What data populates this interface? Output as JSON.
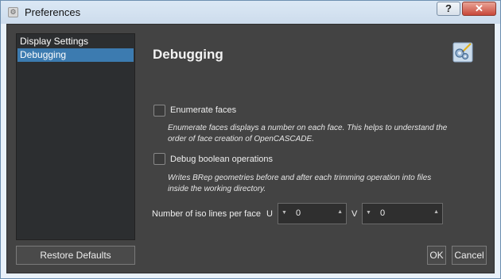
{
  "window": {
    "title": "Preferences",
    "help_label": "?",
    "close_label": "✕"
  },
  "sidebar": {
    "items": [
      {
        "label": "Display Settings"
      },
      {
        "label": "Debugging"
      }
    ]
  },
  "restore_label": "Restore Defaults",
  "page": {
    "title": "Debugging",
    "enumerate": {
      "label": "Enumerate faces",
      "desc1": "Enumerate faces displays a number on each face. This helps to understand the",
      "desc2": "order of face creation of OpenCASCADE."
    },
    "debug_bool": {
      "label": "Debug boolean operations",
      "desc1": "Writes BRep geometries before and after each trimming operation into files",
      "desc2": "inside the working directory."
    },
    "iso": {
      "label": "Number of iso lines per face",
      "u_label": "U",
      "u_value": "0",
      "v_label": "V",
      "v_value": "0"
    }
  },
  "buttons": {
    "ok": "OK",
    "cancel": "Cancel"
  },
  "colors": {
    "accent": "#3c7bb0",
    "panel": "#434343"
  },
  "icons": {
    "title": "gear-icon",
    "header": "gears-pen-icon"
  }
}
